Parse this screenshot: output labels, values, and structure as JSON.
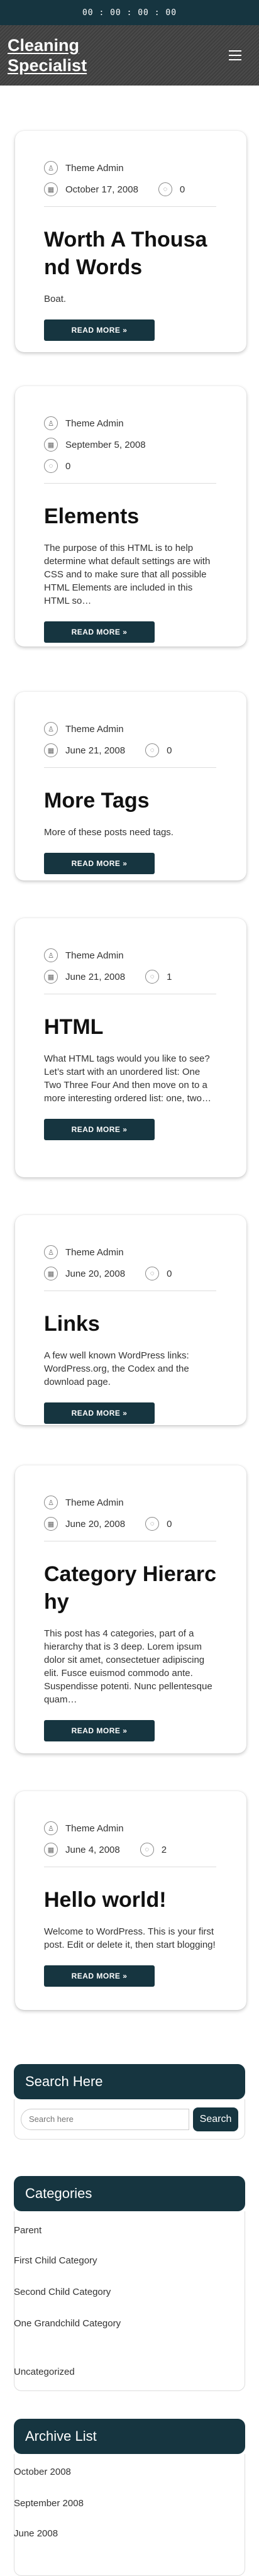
{
  "topbar": {
    "time": "00 : 00 : 00 : 00"
  },
  "header": {
    "site_title": "Cleaning Specialist"
  },
  "posts": [
    {
      "author": "Theme Admin",
      "date": "October 17, 2008",
      "comments": "0",
      "title": "Worth A Thousand Words",
      "excerpt": "Boat.",
      "button": "READ MORE »"
    },
    {
      "author": "Theme Admin",
      "date": "September 5, 2008",
      "comments": "0",
      "title": "Elements",
      "excerpt": "The purpose of this HTML is to help determine what default settings are with CSS and to make sure that all possible HTML Elements are included in this HTML so…",
      "button": "READ MORE »"
    },
    {
      "author": "Theme Admin",
      "date": "June 21, 2008",
      "comments": "0",
      "title": "More Tags",
      "excerpt": "More of these posts need tags.",
      "button": "READ MORE »"
    },
    {
      "author": "Theme Admin",
      "date": "June 21, 2008",
      "comments": "1",
      "title": "HTML",
      "excerpt": "What HTML tags would you like to see? Let’s start with an unordered list: One Two Three Four And then move on to a more interesting ordered list: one, two…",
      "button": "READ MORE »"
    },
    {
      "author": "Theme Admin",
      "date": "June 20, 2008",
      "comments": "0",
      "title": "Links",
      "excerpt": "A few well known WordPress links: WordPress.org, the Codex and the download page.",
      "button": "READ MORE »"
    },
    {
      "author": "Theme Admin",
      "date": "June 20, 2008",
      "comments": "0",
      "title": "Category Hierarchy",
      "excerpt": "This post has 4 categories, part of a hierarchy that is 3 deep. Lorem ipsum dolor sit amet, consectetuer adipiscing elit. Fusce euismod commodo ante. Suspendisse potenti. Nunc pellentesque quam…",
      "button": "READ MORE »"
    },
    {
      "author": "Theme Admin",
      "date": "June 4, 2008",
      "comments": "2",
      "title": "Hello world!",
      "excerpt": "Welcome to WordPress. This is your first post. Edit or delete it, then start blogging!",
      "button": "READ MORE »"
    }
  ],
  "search": {
    "title": "Search Here",
    "placeholder": "Search here",
    "button": "Search"
  },
  "categories": {
    "title": "Categories",
    "items": [
      "Parent",
      "First Child Category",
      "Second Child Category",
      "One Grandchild Category",
      "Uncategorized"
    ]
  },
  "archive": {
    "title": "Archive List",
    "items": [
      "October 2008",
      "September 2008",
      "June 2008"
    ]
  },
  "colors": {
    "accent": "#163540"
  }
}
